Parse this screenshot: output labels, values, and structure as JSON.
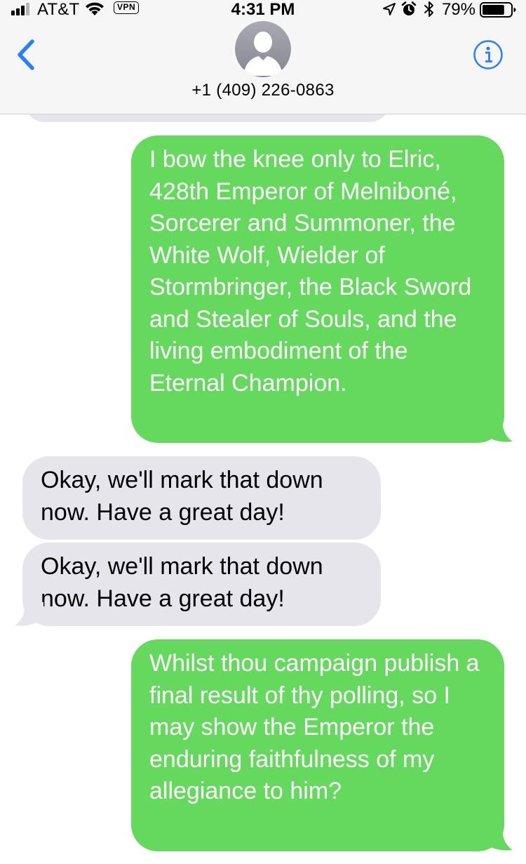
{
  "status_bar": {
    "carrier": "AT&T",
    "vpn_label": "VPN",
    "time": "4:31 PM",
    "battery_percent": "79%",
    "battery_level": 0.79,
    "icons": [
      "signal-icon",
      "wifi-icon",
      "location-icon",
      "alarm-icon",
      "bluetooth-icon",
      "battery-icon"
    ]
  },
  "nav": {
    "back_icon": "chevron-left-icon",
    "contact_name": "+1 (409) 226-0863",
    "avatar_icon": "person-silhouette-icon",
    "info_icon": "info-icon"
  },
  "colors": {
    "sent_bubble": "#65d85e",
    "received_bubble": "#e6e5eb",
    "accent": "#2a7ff6"
  },
  "messages": [
    {
      "direction": "sent",
      "text": "I bow the knee only to Elric, 428th Emperor of Melniboné, Sorcerer and Summoner, the White Wolf, Wielder of Stormbringer, the Black Sword and Stealer of Souls, and the living embodiment of the Eternal Champion."
    },
    {
      "direction": "received",
      "text": "Okay, we'll mark that down now. Have a great day!"
    },
    {
      "direction": "received",
      "text": "Okay, we'll mark that down now. Have a great day!"
    },
    {
      "direction": "sent",
      "text": "Whilst thou campaign publish a final result of thy polling, so I may show the Emperor the enduring faithfulness of my allegiance to him?"
    }
  ]
}
